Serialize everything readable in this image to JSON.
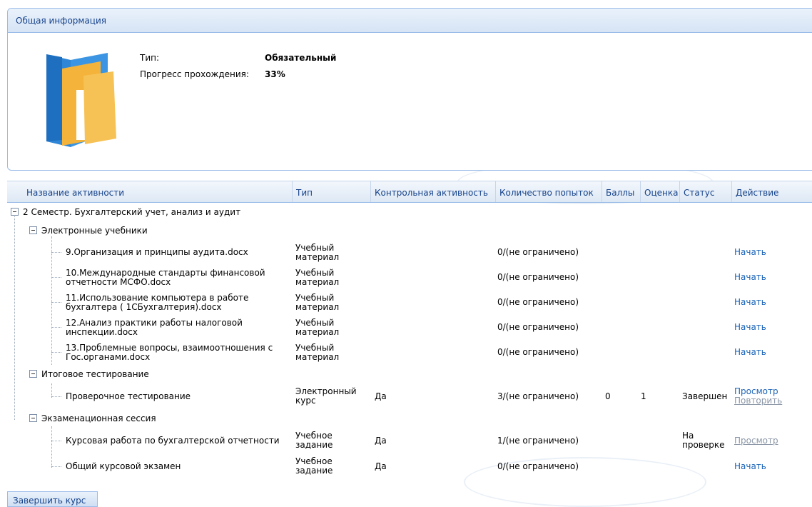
{
  "info_panel": {
    "title": "Общая информация",
    "type_label": "Тип:",
    "type_value": "Обязательный",
    "progress_label": "Прогресс прохождения:",
    "progress_value": "33%",
    "icon": "folder-icon"
  },
  "table": {
    "columns": [
      "Название активности",
      "Тип",
      "Контрольная активность",
      "Количество попыток",
      "Баллы",
      "Оценка",
      "Статус",
      "Действие"
    ],
    "root": "2 Семестр. Бухгалтерский учет, анализ и аудит",
    "groups": [
      {
        "name": "Электронные учебники",
        "items": [
          {
            "name_l1": "9.Организация и принципы аудита.docx",
            "name_l2": "",
            "type_l1": "Учебный",
            "type_l2": "материал",
            "control": "",
            "attempts": "0/(не ограничено)",
            "score": "",
            "grade": "",
            "status_l1": "",
            "status_l2": "",
            "action1": "Начать",
            "action2": ""
          },
          {
            "name_l1": "10.Международные стандарты финансовой",
            "name_l2": "отчетности МСФО.docx",
            "type_l1": "Учебный",
            "type_l2": "материал",
            "control": "",
            "attempts": "0/(не ограничено)",
            "score": "",
            "grade": "",
            "status_l1": "",
            "status_l2": "",
            "action1": "Начать",
            "action2": ""
          },
          {
            "name_l1": "11.Использование компьютера в работе",
            "name_l2": "бухгалтера ( 1СБухгалтерия).docx",
            "type_l1": "Учебный",
            "type_l2": "материал",
            "control": "",
            "attempts": "0/(не ограничено)",
            "score": "",
            "grade": "",
            "status_l1": "",
            "status_l2": "",
            "action1": "Начать",
            "action2": ""
          },
          {
            "name_l1": "12.Анализ практики работы налоговой",
            "name_l2": "инспекции.docx",
            "type_l1": "Учебный",
            "type_l2": "материал",
            "control": "",
            "attempts": "0/(не ограничено)",
            "score": "",
            "grade": "",
            "status_l1": "",
            "status_l2": "",
            "action1": "Начать",
            "action2": ""
          },
          {
            "name_l1": "13.Проблемные вопросы, взаимоотношения с",
            "name_l2": "Гос.органами.docx",
            "type_l1": "Учебный",
            "type_l2": "материал",
            "control": "",
            "attempts": "0/(не ограничено)",
            "score": "",
            "grade": "",
            "status_l1": "",
            "status_l2": "",
            "action1": "Начать",
            "action2": ""
          }
        ]
      },
      {
        "name": "Итоговое тестирование",
        "items": [
          {
            "name_l1": "Проверочное тестирование",
            "name_l2": "",
            "type_l1": "Электронный",
            "type_l2": "курс",
            "control": "Да",
            "attempts": "3/(не ограничено)",
            "score": "0",
            "grade": "1",
            "status_l1": "Завершен",
            "status_l2": "",
            "action1": "Просмотр",
            "action2": "Повторить"
          }
        ]
      },
      {
        "name": "Экзаменационная сессия",
        "items": [
          {
            "name_l1": "Курсовая работа по бухгалтерской отчетности",
            "name_l2": "",
            "type_l1": "Учебное",
            "type_l2": "задание",
            "control": "Да",
            "attempts": "1/(не ограничено)",
            "score": "",
            "grade": "",
            "status_l1": "На",
            "status_l2": "проверке",
            "action1": "Просмотр",
            "action2": ""
          },
          {
            "name_l1": "Общий курсовой экзамен",
            "name_l2": "",
            "type_l1": "Учебное",
            "type_l2": "задание",
            "control": "Да",
            "attempts": "0/(не ограничено)",
            "score": "",
            "grade": "",
            "status_l1": "",
            "status_l2": "",
            "action1": "Начать",
            "action2": ""
          }
        ]
      }
    ]
  },
  "finish_button": "Завершить курс",
  "colors": {
    "panel_border": "#99bbe8",
    "header_text": "#15428b",
    "link": "#1a63b8",
    "link_disabled": "#8a96a6"
  }
}
